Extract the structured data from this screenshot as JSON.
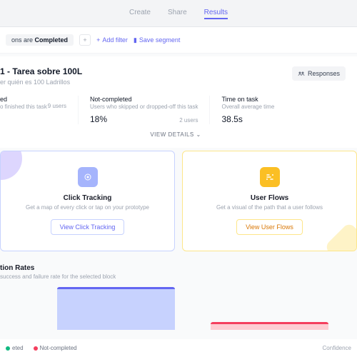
{
  "tabs": {
    "create": "Create",
    "share": "Share",
    "results": "Results"
  },
  "filter": {
    "sessions": "ons are",
    "completed": "Completed",
    "addFilter": "Add filter",
    "saveSegment": "Save segment"
  },
  "task": {
    "title": "1 - Tarea sobre 100L",
    "subtitle": "er quién es 100 Ladrillos",
    "responsesBtn": "Responses"
  },
  "stats": {
    "completed": {
      "label": "ed",
      "sub": "o finished this task",
      "users": "9 users"
    },
    "notCompleted": {
      "label": "Not-completed",
      "sub": "Users who skipped or dropped-off this task",
      "val": "18%",
      "users": "2 users"
    },
    "timeOnTask": {
      "label": "Time on task",
      "sub": "Overall average time",
      "val": "38.5s"
    }
  },
  "viewDetails": "VIEW DETAILS",
  "clickCard": {
    "title": "Click Tracking",
    "desc": "Get a map of every click or tap on your prototype",
    "btn": "View Click Tracking"
  },
  "flowCard": {
    "title": "User Flows",
    "desc": "Get a visual of the path that a user follows",
    "btn": "View User Flows"
  },
  "rates": {
    "title": "tion Rates",
    "sub": "success and failure rate for the selected block"
  },
  "legend": {
    "completed": "eted",
    "notCompleted": "Not-completed",
    "confidence": "Confidence"
  },
  "chart_data": {
    "type": "bar",
    "series": [
      {
        "name": "Completed",
        "value": 82,
        "color": "#6366f1"
      },
      {
        "name": "Not-completed",
        "value": 18,
        "color": "#f43f5e"
      }
    ],
    "ylim": [
      0,
      100
    ]
  }
}
